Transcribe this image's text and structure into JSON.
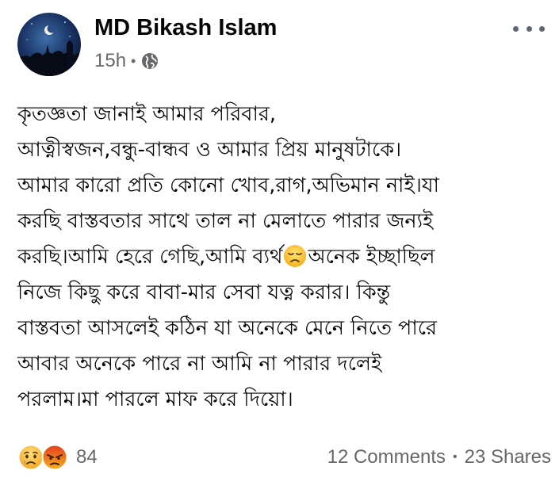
{
  "post": {
    "author": "MD Bikash Islam",
    "time": "15h",
    "separator": "•",
    "privacy_icon": "globe-icon",
    "more_icon": "more-options-icon",
    "text_lines": [
      "কৃতজ্ঞতা জানাই আমার পরিবার,",
      "আত্নীস্বজন,বন্ধু-বান্ধব ও আমার প্রিয় মানুষটাকে।",
      "আমার কারো প্রতি কোনো খোব,রাগ,অভিমান নাই।যা",
      "করছি বাস্তবতার সাথে তাল না মেলাতে পারার জন্যই",
      "করছি।আমি হেরে গেছি,আমি ব্যর্থ",
      "অনেক ইচ্ছাছিল",
      "নিজে কিছু করে বাবা-মার সেবা যত্ন করার। কিন্তু",
      "বাস্তবতা আসলেই কঠিন যা অনেকে মেনে নিতে পারে",
      "আবার অনেকে পারে না আমি না পারার দলেই",
      "পরলাম।মা পারলে মাফ করে দিয়ো।"
    ],
    "inline_emoji": "disappointed-face-emoji"
  },
  "footer": {
    "reaction_icons": [
      "sad-reaction-icon",
      "angry-reaction-icon"
    ],
    "reaction_count": "84",
    "comments": "12 Comments",
    "separator": "•",
    "shares": "23 Shares"
  },
  "colors": {
    "text": "#050505",
    "secondary": "#65676b",
    "sad_yellow": "#f7b125",
    "angry_red": "#e9710f",
    "avatar_sky": "#0b1a3a"
  }
}
